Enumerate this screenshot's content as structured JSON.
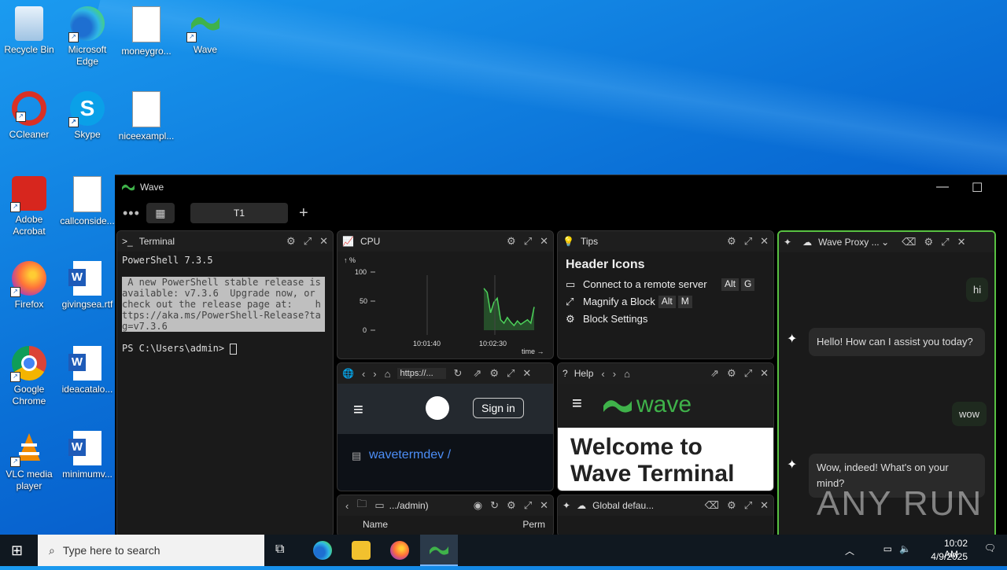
{
  "desktop": {
    "icons": [
      {
        "label": "Recycle Bin",
        "name": "recycle-bin-icon"
      },
      {
        "label": "Microsoft Edge",
        "name": "edge-icon"
      },
      {
        "label": "moneygro...",
        "name": "image-file-icon"
      },
      {
        "label": "Wave",
        "name": "wave-icon"
      },
      {
        "label": "CCleaner",
        "name": "ccleaner-icon"
      },
      {
        "label": "Skype",
        "name": "skype-icon"
      },
      {
        "label": "niceexampl...",
        "name": "image-file-icon"
      },
      {
        "label": "Adobe Acrobat",
        "name": "acrobat-icon"
      },
      {
        "label": "callconside...",
        "name": "image-file-icon"
      },
      {
        "label": "Firefox",
        "name": "firefox-icon"
      },
      {
        "label": "givingsea.rtf",
        "name": "word-doc-icon"
      },
      {
        "label": "Google Chrome",
        "name": "chrome-icon"
      },
      {
        "label": "ideacatalo...",
        "name": "word-doc-icon"
      },
      {
        "label": "VLC media player",
        "name": "vlc-icon"
      },
      {
        "label": "minimumv...",
        "name": "word-doc-icon"
      }
    ]
  },
  "window": {
    "title": "Wave",
    "tab_label": "T1",
    "dots": "•••"
  },
  "terminal": {
    "title": "Terminal",
    "line1": "PowerShell 7.3.5",
    "notice": " A new PowerShell stable release is available: v7.3.6  Upgrade now, or check out the release page at:    https://aka.ms/PowerShell-Release?tag=v7.3.6",
    "prompt": "PS C:\\Users\\admin> "
  },
  "cpu": {
    "title": "CPU",
    "ylabel": "↑ %",
    "ticks": [
      "100",
      "50",
      "0"
    ],
    "xticks": [
      "10:01:40",
      "10:02:30"
    ],
    "xlabel": "time →"
  },
  "chart_data": {
    "type": "area",
    "title": "CPU",
    "ylabel": "%",
    "xlabel": "time",
    "ylim": [
      0,
      100
    ],
    "x": [
      0,
      1,
      2,
      3,
      4,
      5,
      6,
      7,
      8,
      9,
      10,
      11,
      12,
      13,
      14,
      15
    ],
    "series": [
      {
        "name": "CPU",
        "values": [
          72,
          65,
          30,
          48,
          55,
          18,
          12,
          22,
          14,
          8,
          16,
          10,
          14,
          18,
          12,
          40
        ]
      }
    ],
    "grid": false
  },
  "tips": {
    "title": "Tips",
    "heading": "Header Icons",
    "items": [
      {
        "label": "Connect to a remote server",
        "keys": [
          "Alt",
          "G"
        ]
      },
      {
        "label": "Magnify a Block",
        "keys": [
          "Alt",
          "M"
        ]
      },
      {
        "label": "Block Settings",
        "keys": []
      }
    ]
  },
  "web": {
    "url": "https://...",
    "sign_in": "Sign in",
    "repo": "wavetermdev /"
  },
  "help": {
    "title": "Help",
    "brand": "wave",
    "welcome": "Welcome to Wave Terminal"
  },
  "files": {
    "path": ".../admin)",
    "col_name": "Name",
    "col_perm": "Perm"
  },
  "ai_small": {
    "title": "Global defau..."
  },
  "ai": {
    "title": "Wave Proxy ...",
    "messages": [
      {
        "role": "user",
        "text": "hi"
      },
      {
        "role": "assistant",
        "text": "Hello! How can I assist you today?"
      },
      {
        "role": "user",
        "text": "wow"
      },
      {
        "role": "assistant",
        "text": "Wow, indeed! What's on your mind?"
      }
    ]
  },
  "taskbar": {
    "search_placeholder": "Type here to search",
    "time": "10:02 AM",
    "date": "4/9/2025"
  },
  "watermark": "ANY RUN"
}
